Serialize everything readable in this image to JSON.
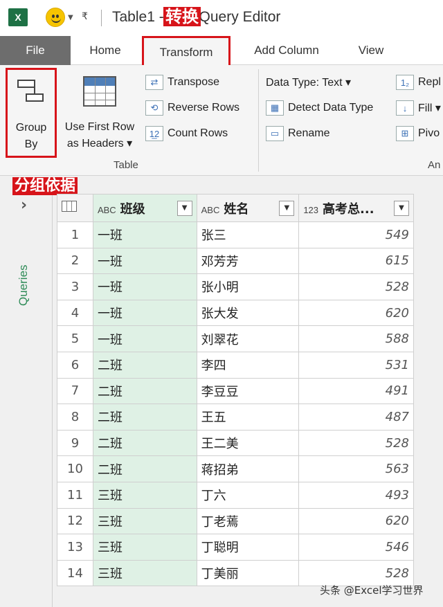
{
  "titlebar": {
    "title": "Table1 - Power Query Editor",
    "title_visible": "Table1 -",
    "title_tail": "r Query Editor",
    "annotation_convert": "转换"
  },
  "tabs": [
    {
      "label": "File"
    },
    {
      "label": "Home"
    },
    {
      "label": "Transform",
      "selected": true
    },
    {
      "label": "Add Column"
    },
    {
      "label": "View"
    }
  ],
  "ribbon": {
    "group_by": "Group By",
    "group_by_lines": [
      "Group",
      "By"
    ],
    "use_first_row": [
      "Use First Row",
      "as Headers ▾"
    ],
    "transpose": "Transpose",
    "reverse_rows": "Reverse Rows",
    "count_rows": "Count Rows",
    "table_group_label": "Table",
    "data_type": "Data Type: Text ▾",
    "detect_data_type": "Detect Data Type",
    "rename": "Rename",
    "replace": "Repl",
    "fill": "Fill ▾",
    "pivot": "Pivo",
    "any_group_label": "An",
    "icons": {
      "group_by": "group-by-icon",
      "transpose": "transpose-icon",
      "reverse": "reverse-rows-icon",
      "count": "count-rows-icon",
      "detect": "detect-type-icon",
      "rename": "rename-icon",
      "replace": "replace-icon",
      "fill": "fill-down-icon",
      "pivot": "pivot-icon"
    }
  },
  "annotation_group": "分组依据",
  "queries_pane": {
    "label": "Queries",
    "chevron": "›"
  },
  "grid": {
    "headers": [
      {
        "type": "ABC",
        "label": "班级"
      },
      {
        "type": "ABC",
        "label": "姓名"
      },
      {
        "type": "123",
        "label": "高考总..."
      }
    ],
    "rows": [
      {
        "idx": "1",
        "class": "一班",
        "name": "张三",
        "score": "549"
      },
      {
        "idx": "2",
        "class": "一班",
        "name": "邓芳芳",
        "score": "615"
      },
      {
        "idx": "3",
        "class": "一班",
        "name": "张小明",
        "score": "528"
      },
      {
        "idx": "4",
        "class": "一班",
        "name": "张大发",
        "score": "620"
      },
      {
        "idx": "5",
        "class": "一班",
        "name": "刘翠花",
        "score": "588"
      },
      {
        "idx": "6",
        "class": "二班",
        "name": "李四",
        "score": "531"
      },
      {
        "idx": "7",
        "class": "二班",
        "name": "李豆豆",
        "score": "491"
      },
      {
        "idx": "8",
        "class": "二班",
        "name": "王五",
        "score": "487"
      },
      {
        "idx": "9",
        "class": "二班",
        "name": "王二美",
        "score": "528"
      },
      {
        "idx": "10",
        "class": "二班",
        "name": "蒋招弟",
        "score": "563"
      },
      {
        "idx": "11",
        "class": "三班",
        "name": "丁六",
        "score": "493"
      },
      {
        "idx": "12",
        "class": "三班",
        "name": "丁老蔫",
        "score": "620"
      },
      {
        "idx": "13",
        "class": "三班",
        "name": "丁聪明",
        "score": "546"
      },
      {
        "idx": "14",
        "class": "三班",
        "name": "丁美丽",
        "score": "528"
      }
    ]
  },
  "watermark": "头条 @Excel学习世界",
  "colors": {
    "annotation_red": "#d7141a",
    "selected_column_green": "#dff1e5",
    "excel_green": "#1e7145",
    "file_tab_gray": "#6d6d6d"
  }
}
